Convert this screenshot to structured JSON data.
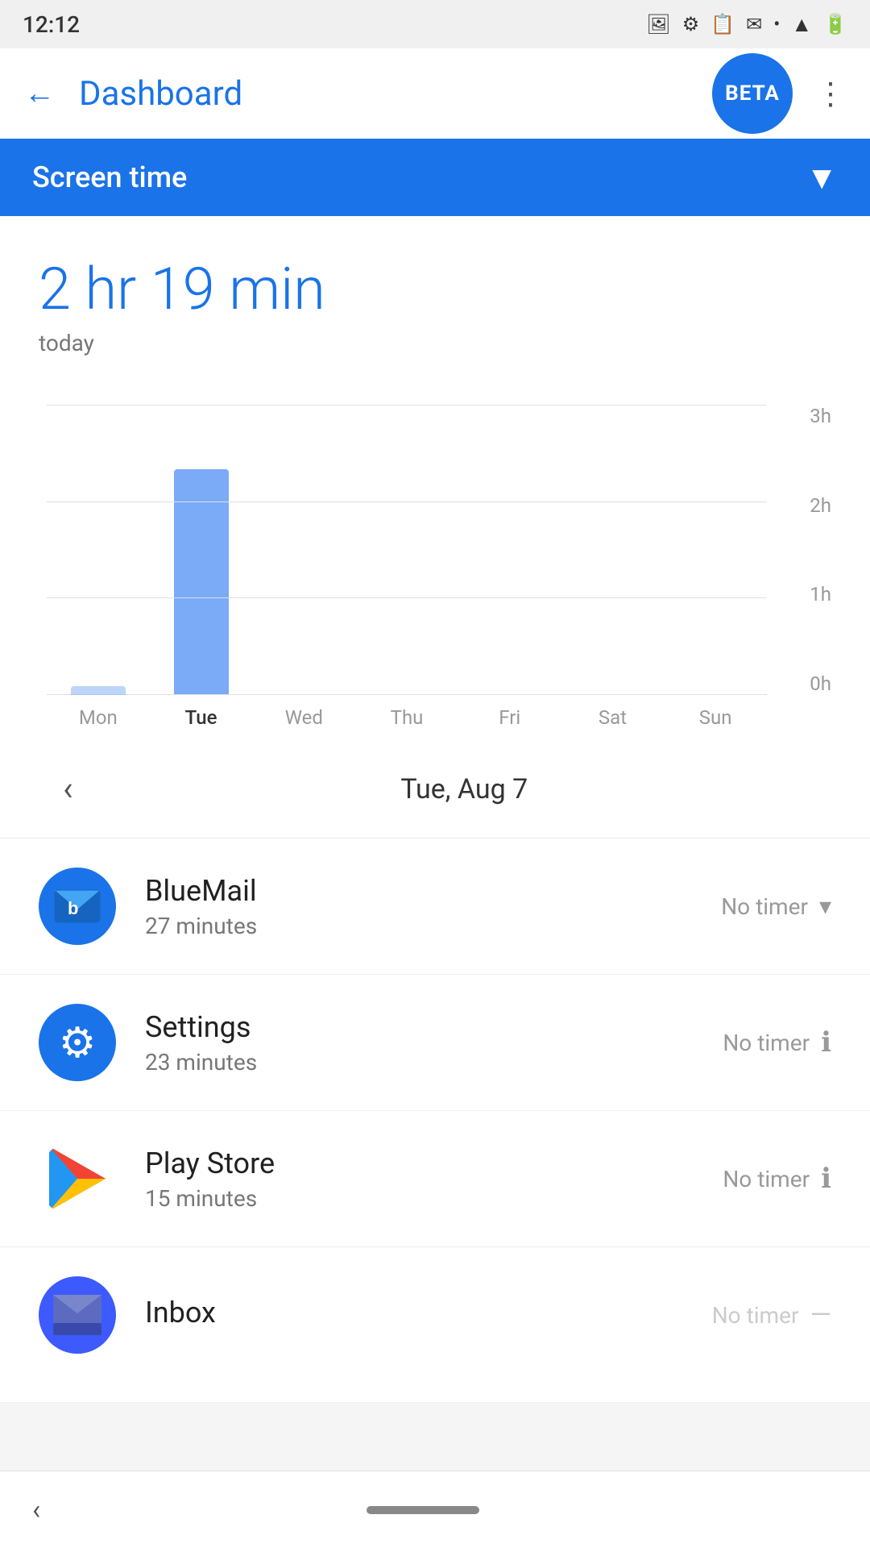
{
  "statusBar": {
    "time": "12:12",
    "icons": [
      "photo",
      "games",
      "clipboard",
      "email",
      "dot"
    ]
  },
  "appBar": {
    "backLabel": "←",
    "title": "Dashboard",
    "betaBadge": "BETA",
    "moreIcon": "⋮"
  },
  "screenTime": {
    "label": "Screen time",
    "chevron": "▼"
  },
  "totalTime": {
    "value": "2 hr 19 min",
    "period": "today"
  },
  "chart": {
    "yLabels": [
      "3h",
      "2h",
      "1h",
      "0h"
    ],
    "xLabels": [
      "Mon",
      "Tue",
      "Wed",
      "Thu",
      "Fri",
      "Sat",
      "Sun"
    ],
    "activeDay": "Tue",
    "bars": [
      {
        "day": "Mon",
        "heightPct": 3
      },
      {
        "day": "Tue",
        "heightPct": 77
      },
      {
        "day": "Wed",
        "heightPct": 0
      },
      {
        "day": "Thu",
        "heightPct": 0
      },
      {
        "day": "Fri",
        "heightPct": 0
      },
      {
        "day": "Sat",
        "heightPct": 0
      },
      {
        "day": "Sun",
        "heightPct": 0
      }
    ]
  },
  "dateNav": {
    "backBtn": "‹",
    "date": "Tue, Aug 7"
  },
  "apps": [
    {
      "name": "BlueMail",
      "time": "27 minutes",
      "timer": "No timer",
      "timerControl": "dropdown"
    },
    {
      "name": "Settings",
      "time": "23 minutes",
      "timer": "No timer",
      "timerControl": "info"
    },
    {
      "name": "Play Store",
      "time": "15 minutes",
      "timer": "No timer",
      "timerControl": "info"
    },
    {
      "name": "Inbox",
      "time": "",
      "timer": "No timer",
      "timerControl": "dash"
    }
  ],
  "bottomNav": {
    "backLabel": "‹"
  }
}
